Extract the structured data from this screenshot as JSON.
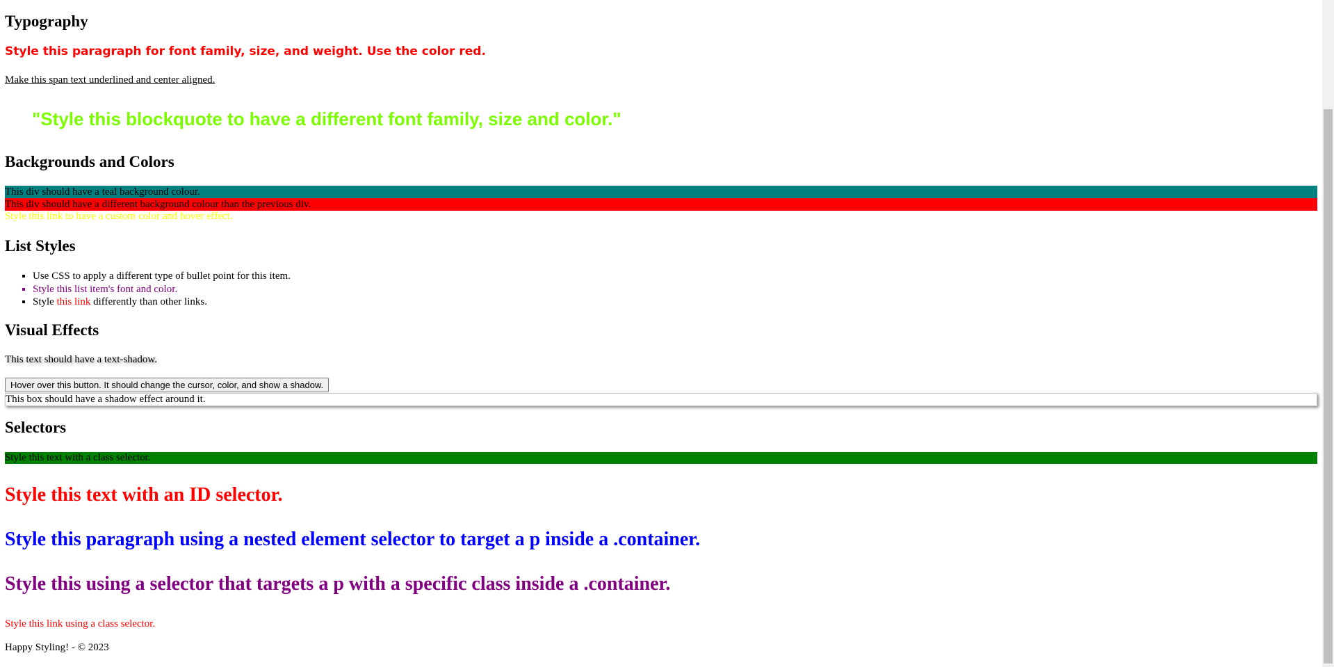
{
  "typography": {
    "heading": "Typography",
    "paragraph": "Style this paragraph for font family, size, and weight. Use the color red.",
    "span": "Make this span text underlined and center aligned.",
    "blockquote": "\"Style this blockquote to have a different font family, size and color.\""
  },
  "backgrounds": {
    "heading": "Backgrounds and Colors",
    "teal_div": "This div should have a teal background colour.",
    "red_div": "This div should have a different background colour than the previous div.",
    "link": "Style this link to have a custom color and hover effect."
  },
  "lists": {
    "heading": "List Styles",
    "item1": "Use CSS to apply a different type of bullet point for this item.",
    "item2": "Style this list item's font and color.",
    "item3_before": "Style ",
    "item3_link": "this link",
    "item3_after": " differently than other links."
  },
  "effects": {
    "heading": "Visual Effects",
    "shadow_text": "This text should have a text-shadow.",
    "button": "Hover over this button. It should change the cursor, color, and show a shadow.",
    "box": "This box should have a shadow effect around it."
  },
  "selectors": {
    "heading": "Selectors",
    "class_text": "Style this text with a class selector.",
    "id_text": "Style this text with an ID selector.",
    "nested_text": "Style this paragraph using a nested element selector to target a p inside a .container.",
    "specific_text": "Style this using a selector that targets a p with a specific class inside a .container.",
    "class_link": "Style this link using a class selector."
  },
  "footer": "Happy Styling! - © 2023",
  "colors": {
    "teal": "#008080",
    "red": "#ff0000",
    "lime": "#7cfc00",
    "yellow": "#ffff00",
    "purple": "#800080",
    "green": "#008000",
    "blue": "#0000ff"
  }
}
